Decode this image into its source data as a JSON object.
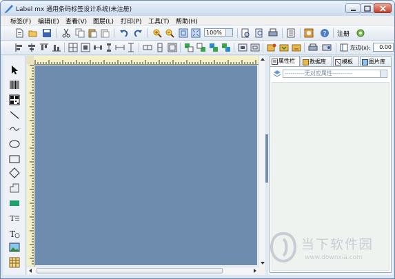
{
  "window": {
    "title": "Label mx 通用条码标签设计系统(未注册)"
  },
  "menu": [
    "标签(F)",
    "编辑(E)",
    "查看(V)",
    "图层(L)",
    "打印(P)",
    "工具(T)",
    "帮助(H)"
  ],
  "toolbar": {
    "zoom_value": "100%",
    "register_label": "注册",
    "margin_left_label": "左边(x):",
    "margin_left_value": "0.00"
  },
  "panel": {
    "tabs": [
      "属性栏",
      "数据库",
      "模板",
      "图片库"
    ],
    "active_tab": "属性栏",
    "property_selector": "----------无对应属性----------"
  },
  "watermark": {
    "text": "当下软件园",
    "url": "www.downxia.com"
  },
  "colors": {
    "canvas_bg": "#6e8cad",
    "ruler_bg": "#f4f1c8",
    "window_border": "#6d8bb0"
  }
}
